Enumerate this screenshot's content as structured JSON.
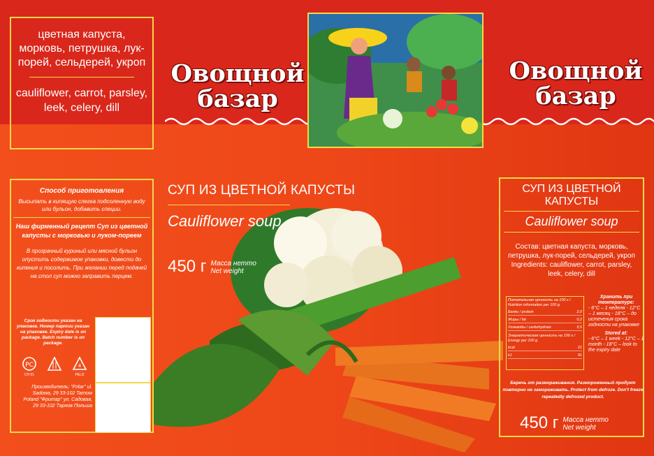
{
  "brand": {
    "name_line1": "Овощной",
    "name_line2": "базар"
  },
  "ingredients_panel": {
    "ru": "цветная капуста, морковь, петрушка, лук-порей, сельдерей, укроп",
    "en": "cauliflower, carrot, parsley, leek, celery, dill"
  },
  "left_panel": {
    "prep_heading": "Способ приготовления",
    "prep_text": "Высыпать в кипящую слегка подсоленную воду или бульон, добавить специи.",
    "recipe_heading": "Наш фирменный рецепт Суп из цветной капусты с морковью и луком-пореем",
    "recipe_text": "В прозрачный куриный или мясной бульон опустить содержимое упаковки, довести до кипения и посолить. При желании перед подачей на стол суп можно заправить перцем.",
    "expiry_text": "Срок годности указан на упаковке. Номер партии указан на упаковке. Expiry date is on package. Batch number is on package.",
    "marks": [
      "CH 01",
      "",
      "PELD"
    ],
    "producer": "Производитель: \"Fritar\" ul. Sadowa, 29 33-102 Tarnow Poland \"Фритар\" ул. Садовая, 29 33-102 Тарнов Польша"
  },
  "center": {
    "title_ru": "СУП ИЗ ЦВЕТНОЙ КАПУСТЫ",
    "title_en": "Cauliflower soup",
    "weight": "450 г",
    "weight_label_ru": "Масса нетто",
    "weight_label_en": "Net weight"
  },
  "right_panel": {
    "title_ru": "СУП ИЗ ЦВЕТНОЙ КАПУСТЫ",
    "title_en": "Cauliflower soup",
    "composition": "Состав: цветная капуста, морковь, петрушка, лук-порей, сельдерей, укроп Ingredients: cauliflower, carrot, parsley, leek, celery, dill",
    "nutrition_heading": "Питательная ценность на 100 г / Nutrition information per 100 g",
    "nutrition_rows": [
      {
        "label": "Белки / protein",
        "value": "2,0"
      },
      {
        "label": "Жиры / fat",
        "value": "0,2"
      },
      {
        "label": "Углеводы / carbohydrate",
        "value": "5,5"
      }
    ],
    "energy_heading": "Энергетическая ценность на 100 г / Energy per 100 g",
    "energy_rows": [
      {
        "label": "kcal",
        "value": "21"
      },
      {
        "label": "kJ",
        "value": "91"
      }
    ],
    "store_heading_ru": "Хранить при температуре:",
    "store_ru": "- 6°С – 1 неделя - 12°С – 1 месяц - 18°С – до истечения срока годности на упаковке",
    "store_heading_en": "Stored at:",
    "store_en": "- 6°C – 1 week - 12°C – 1 month - 18°C – look to the expiry date",
    "warning": "Беречь от размораживания. Размороженный продукт повторно не замораживать. Protect from defroze. Don't freeze repeatedly defrozed product.",
    "weight": "450 г",
    "weight_label_ru": "Масса нетто",
    "weight_label_en": "Net weight"
  }
}
